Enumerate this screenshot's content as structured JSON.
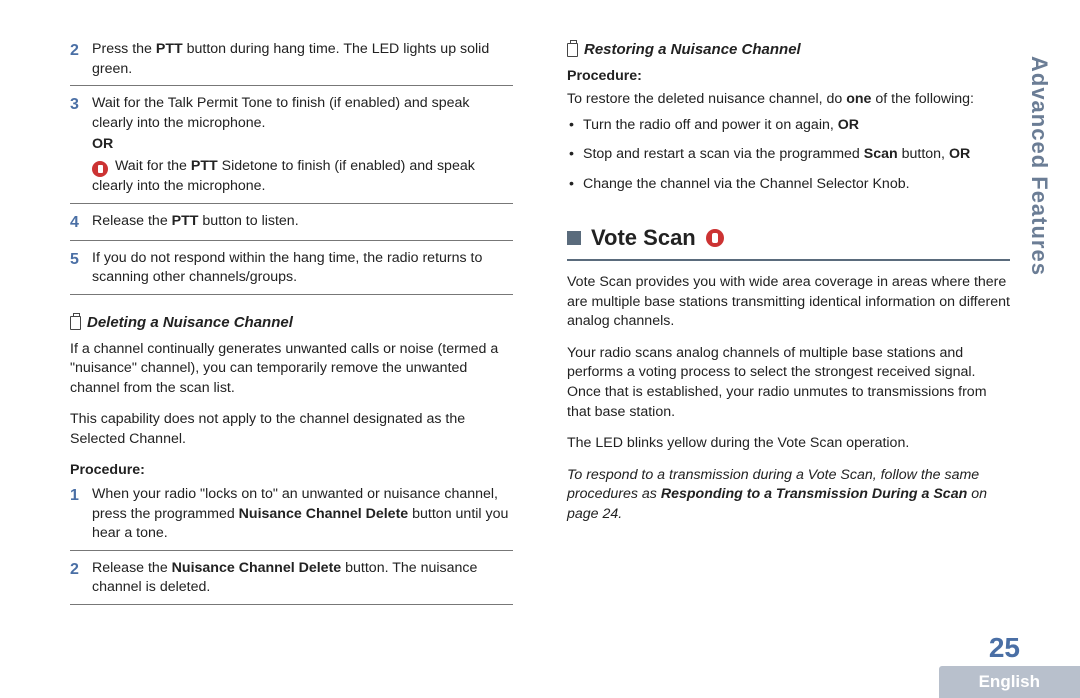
{
  "sideTab": "Advanced Features",
  "pageNumber": "25",
  "languageTab": "English",
  "left": {
    "steps_a": [
      {
        "num": "2",
        "pre": "Press the ",
        "b1": "PTT",
        "post": " button during hang time. The LED lights up solid green."
      },
      {
        "num": "3",
        "pre": "Wait for the Talk Permit Tone to finish (if enabled) and speak clearly into the microphone.",
        "or": "OR",
        "alt_pre": " Wait for the ",
        "alt_b": "PTT",
        "alt_post": " Sidetone to finish (if enabled) and speak clearly into the microphone."
      },
      {
        "num": "4",
        "pre": "Release the ",
        "b1": "PTT",
        "post": " button to listen."
      },
      {
        "num": "5",
        "pre": "If you do not respond within the hang time, the radio returns to scanning other channels/groups."
      }
    ],
    "subhead1": "Deleting a Nuisance Channel",
    "intro1": "If a channel continually generates unwanted calls or noise (termed a \"nuisance\" channel), you can temporarily remove the unwanted channel from the scan list.",
    "intro2": "This capability does not apply to the channel designated as the Selected Channel.",
    "procLabel": "Procedure:",
    "steps_b": [
      {
        "num": "1",
        "pre": "When your radio \"locks on to\" an unwanted or nuisance channel, press the programmed ",
        "b1": "Nuisance Channel Delete",
        "post": " button until you hear a tone."
      },
      {
        "num": "2",
        "pre": "Release the ",
        "b1": "Nuisance Channel Delete",
        "post": " button. The nuisance channel is deleted."
      }
    ]
  },
  "right": {
    "subhead1": "Restoring a Nuisance Channel",
    "procLabel": "Procedure:",
    "restoreIntro_pre": "To restore the deleted nuisance channel, do ",
    "restoreIntro_b": "one",
    "restoreIntro_post": " of the following:",
    "bullets": [
      {
        "text": "Turn the radio off and power it on again, ",
        "tail_b": "OR"
      },
      {
        "text": "Stop and restart a scan via the programmed ",
        "mid_b": "Scan",
        "mid_post": " button, ",
        "tail_b": "OR"
      },
      {
        "text": "Change the channel via the Channel Selector Knob."
      }
    ],
    "mainHead": "Vote Scan",
    "para1": "Vote Scan provides you with wide area coverage in areas where there are multiple base stations transmitting identical information on different analog channels.",
    "para2": "Your radio scans analog channels of multiple base stations and performs a voting process to select the strongest received signal. Once that is established, your radio unmutes to transmissions from that base station.",
    "para3": "The LED blinks yellow during the Vote Scan operation.",
    "note_pre": "To respond to a transmission during a Vote Scan, follow the same procedures as ",
    "note_b": "Responding to a Transmission During a Scan",
    "note_post": " on page 24."
  }
}
